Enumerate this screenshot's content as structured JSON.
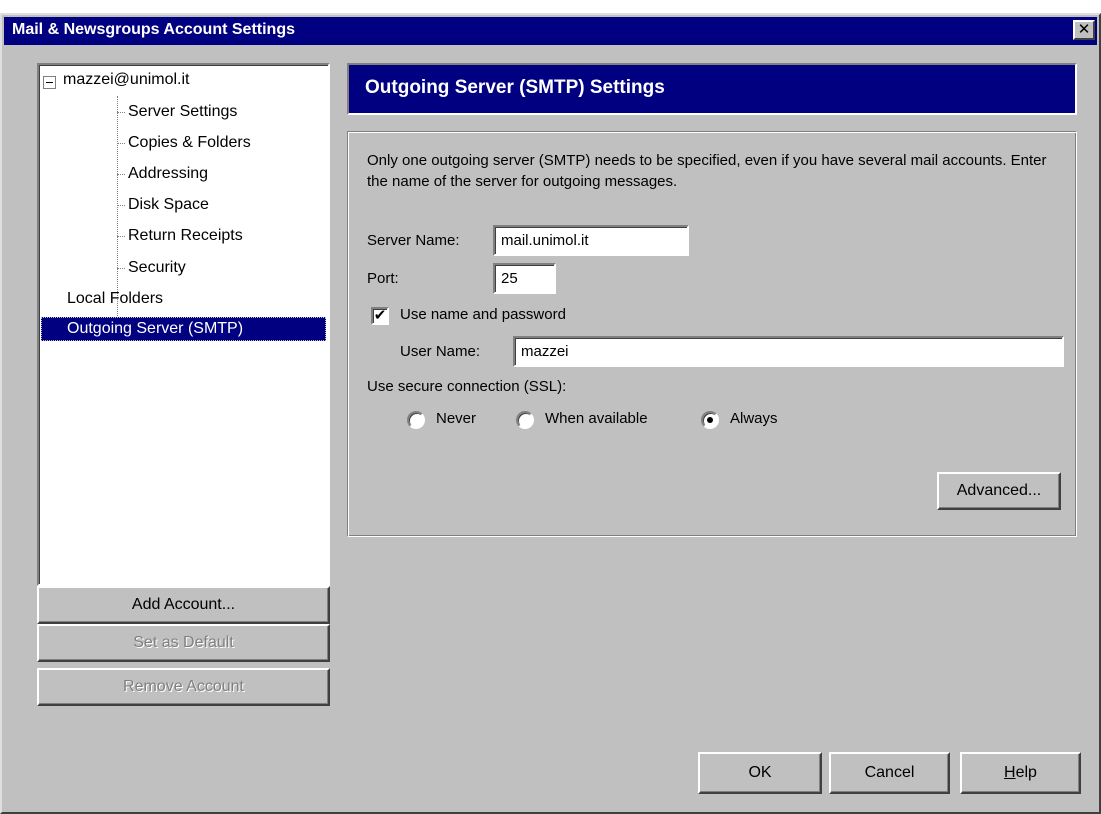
{
  "window": {
    "title": "Mail & Newsgroups Account Settings",
    "close_symbol": "✕"
  },
  "tree": {
    "account": "mazzei@unimol.it",
    "children": [
      "Server Settings",
      "Copies & Folders",
      "Addressing",
      "Disk Space",
      "Return Receipts",
      "Security"
    ],
    "local_folders": "Local Folders",
    "outgoing_server": "Outgoing Server (SMTP)",
    "selected": "Outgoing Server (SMTP)"
  },
  "account_buttons": {
    "add": "Add Account...",
    "set_default": "Set as Default",
    "remove": "Remove Account"
  },
  "panel": {
    "header": "Outgoing Server (SMTP) Settings",
    "description": "Only one outgoing server (SMTP) needs to be specified, even if you have several mail accounts. Enter the name of the server for outgoing messages.",
    "server_name_label": "Server Name:",
    "server_name_value": "mail.unimol.it",
    "port_label": "Port:",
    "port_value": "25",
    "use_name_password_label": "Use name and password",
    "use_name_password_checked": true,
    "user_name_label": "User Name:",
    "user_name_value": "mazzei",
    "ssl_label": "Use secure connection (SSL):",
    "ssl_options": [
      "Never",
      "When available",
      "Always"
    ],
    "ssl_selected": "Always",
    "advanced_button": "Advanced..."
  },
  "footer": {
    "ok": "OK",
    "cancel": "Cancel",
    "help": "Help"
  }
}
